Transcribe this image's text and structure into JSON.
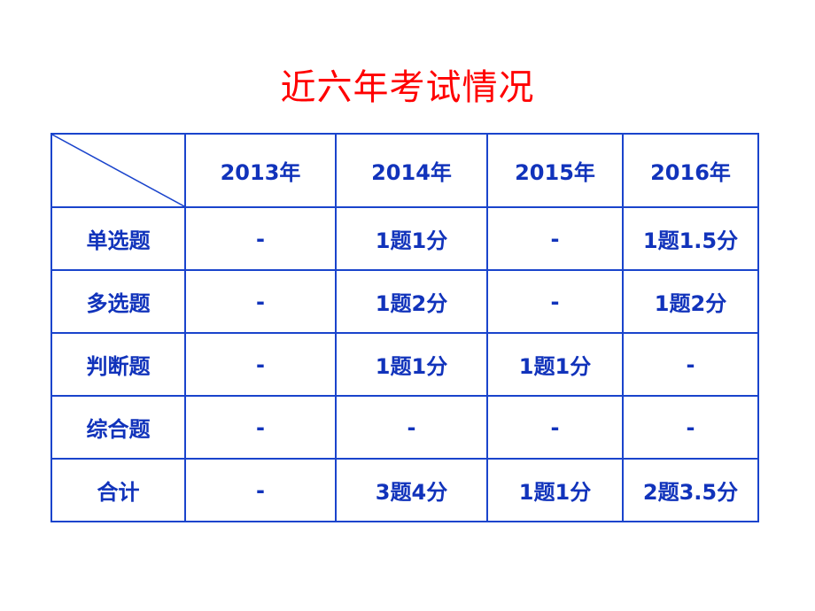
{
  "title": "近六年考试情况",
  "table": {
    "headers": [
      "",
      "2013年",
      "2014年",
      "2015年",
      "2016年"
    ],
    "rows": [
      {
        "label": "单选题",
        "cells": [
          "-",
          "1题1分",
          "-",
          "1题1.5分"
        ]
      },
      {
        "label": "多选题",
        "cells": [
          "-",
          "1题2分",
          "-",
          "1题2分"
        ]
      },
      {
        "label": "判断题",
        "cells": [
          "-",
          "1题1分",
          "1题1分",
          "-"
        ]
      },
      {
        "label": "综合题",
        "cells": [
          "-",
          "-",
          "-",
          "-"
        ]
      },
      {
        "label": "合计",
        "cells": [
          "-",
          "3题4分",
          "1题1分",
          "2题3.5分"
        ]
      }
    ]
  },
  "colors": {
    "title": "#ff0000",
    "table_text": "#1133bb",
    "border": "#1a44cc"
  }
}
